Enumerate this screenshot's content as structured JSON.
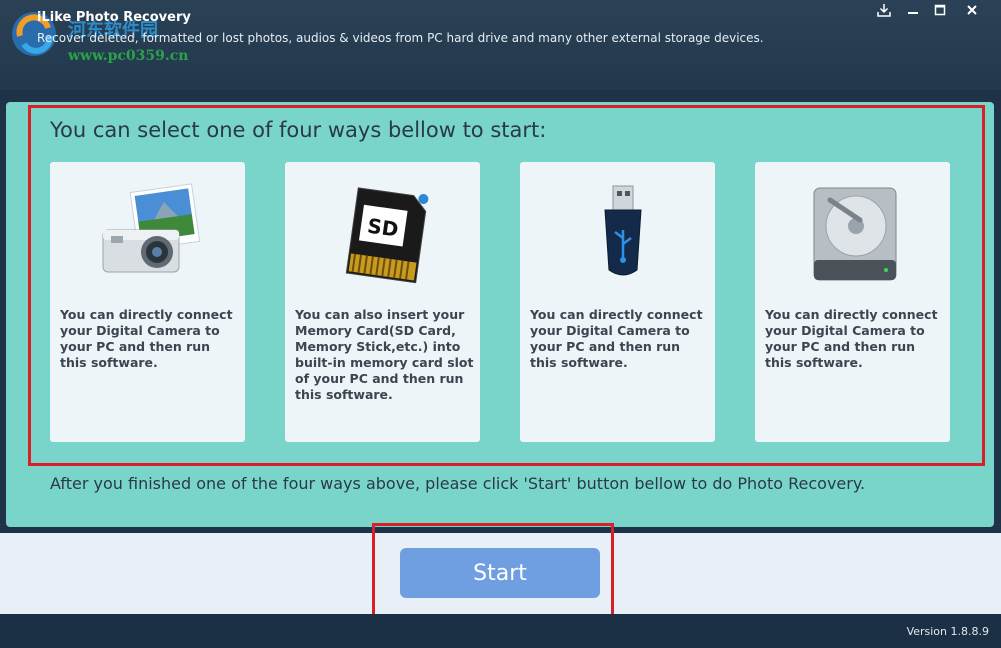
{
  "app": {
    "title": "iLike Photo Recovery",
    "subtitle": "Recover deleted, formatted or lost photos, audios & videos from PC hard drive and many other external storage devices.",
    "watermark": "河东软件园",
    "watermark_url": "www.pc0359.cn"
  },
  "window_controls": [
    "download-icon",
    "minimize-icon",
    "maximize-icon",
    "close-icon"
  ],
  "main": {
    "heading": "You can select one of four ways bellow to start:",
    "cards": [
      {
        "icon": "camera-icon",
        "text": "You can directly connect your Digital Camera to your PC and then run this software."
      },
      {
        "icon": "sd-card-icon",
        "icon_label": "SD",
        "text": "You can also insert your Memory Card(SD Card, Memory Stick,etc.) into built-in memory card slot of your PC and then run this software."
      },
      {
        "icon": "usb-drive-icon",
        "text": "You can directly connect your Digital Camera to your PC and then run this software."
      },
      {
        "icon": "hard-drive-icon",
        "text": "You can directly connect your Digital Camera to your PC and then run this software."
      }
    ],
    "footnote": "After you finished one of the four ways above, please click 'Start' button bellow to do Photo Recovery."
  },
  "actions": {
    "start_label": "Start"
  },
  "status": {
    "version": "Version 1.8.8.9"
  },
  "colors": {
    "accent": "#79d5ca",
    "highlight": "#d92028",
    "button": "#6f9fe0",
    "titlebar": "#22384c"
  }
}
